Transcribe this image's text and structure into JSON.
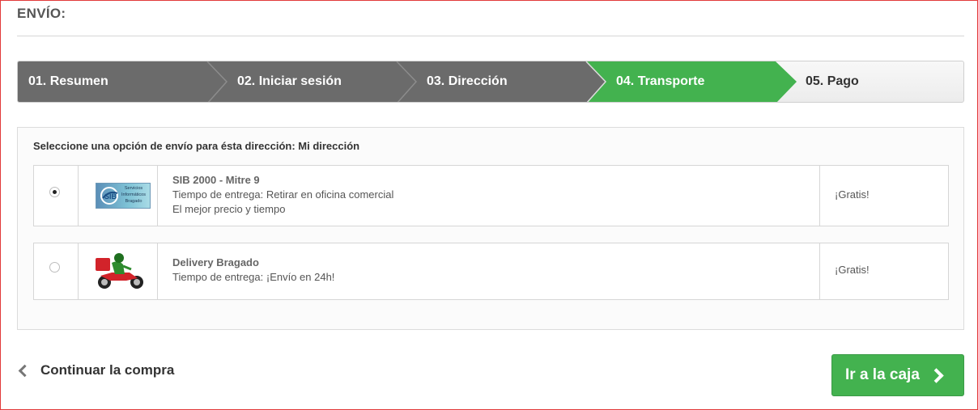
{
  "page": {
    "title": "ENVÍO:"
  },
  "steps": [
    {
      "label": "01. Resumen",
      "state": "done"
    },
    {
      "label": "02. Iniciar sesión",
      "state": "done"
    },
    {
      "label": "03. Dirección",
      "state": "done"
    },
    {
      "label": "04. Transporte",
      "state": "current"
    },
    {
      "label": "05. Pago",
      "state": "todo"
    }
  ],
  "colors": {
    "done": "#6b6b6b",
    "current": "#43b24f",
    "todo": "#f2f2f2"
  },
  "delivery": {
    "heading": "Seleccione una opción de envío para ésta dirección: Mi dirección",
    "options": [
      {
        "selected": true,
        "logo_icon": "sib-servicios-logo",
        "logo_text": [
          "Servicios",
          "Informáticos",
          "Bragado"
        ],
        "name": "SIB 2000 - Mitre 9",
        "delivery_time": "Tiempo de entrega: Retirar en oficina comercial",
        "note": "El mejor precio y tiempo",
        "price": "¡Gratis!"
      },
      {
        "selected": false,
        "logo_icon": "delivery-motorbike-icon",
        "name": "Delivery Bragado",
        "delivery_time": "Tiempo de entrega: ¡Envío en 24h!",
        "price": "¡Gratis!"
      }
    ]
  },
  "actions": {
    "continue_label": "Continuar la compra",
    "checkout_label": "Ir a la caja"
  }
}
